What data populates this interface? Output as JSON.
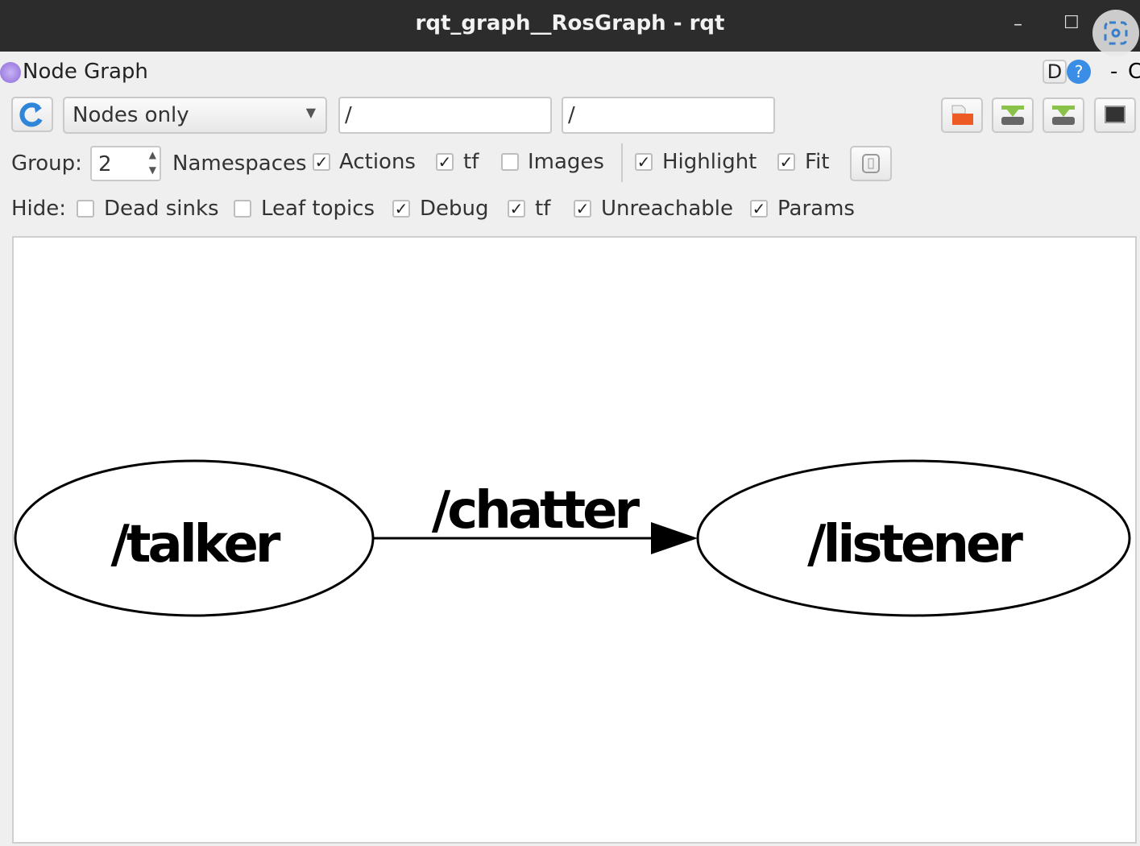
{
  "window": {
    "title": "rqt_graph__RosGraph - rqt",
    "minimize": "–",
    "maximize": "☐",
    "close": "×"
  },
  "plugin": {
    "title": "Node Graph",
    "d_label": "D",
    "help_label": "?",
    "dash": "-",
    "close_label": "C"
  },
  "toolbar": {
    "mode_value": "Nodes only",
    "node_filter": "/",
    "topic_filter": "/"
  },
  "options": {
    "group_label": "Group:",
    "group_value": "2",
    "row1": [
      {
        "label": "Namespaces",
        "checked": null
      },
      {
        "label": "Actions",
        "checked": true
      },
      {
        "label": "tf",
        "checked": true
      },
      {
        "label": "Images",
        "checked": false
      },
      {
        "label": "Highlight",
        "checked": true
      },
      {
        "label": "Fit",
        "checked": true
      }
    ],
    "hide_label": "Hide:",
    "row2": [
      {
        "label": "Dead sinks",
        "checked": false
      },
      {
        "label": "Leaf topics",
        "checked": false
      },
      {
        "label": "Debug",
        "checked": true
      },
      {
        "label": "tf",
        "checked": true
      },
      {
        "label": "Unreachable",
        "checked": true
      },
      {
        "label": "Params",
        "checked": true
      }
    ]
  },
  "graph": {
    "nodes": [
      "/talker",
      "/listener"
    ],
    "edge_label": "/chatter"
  }
}
